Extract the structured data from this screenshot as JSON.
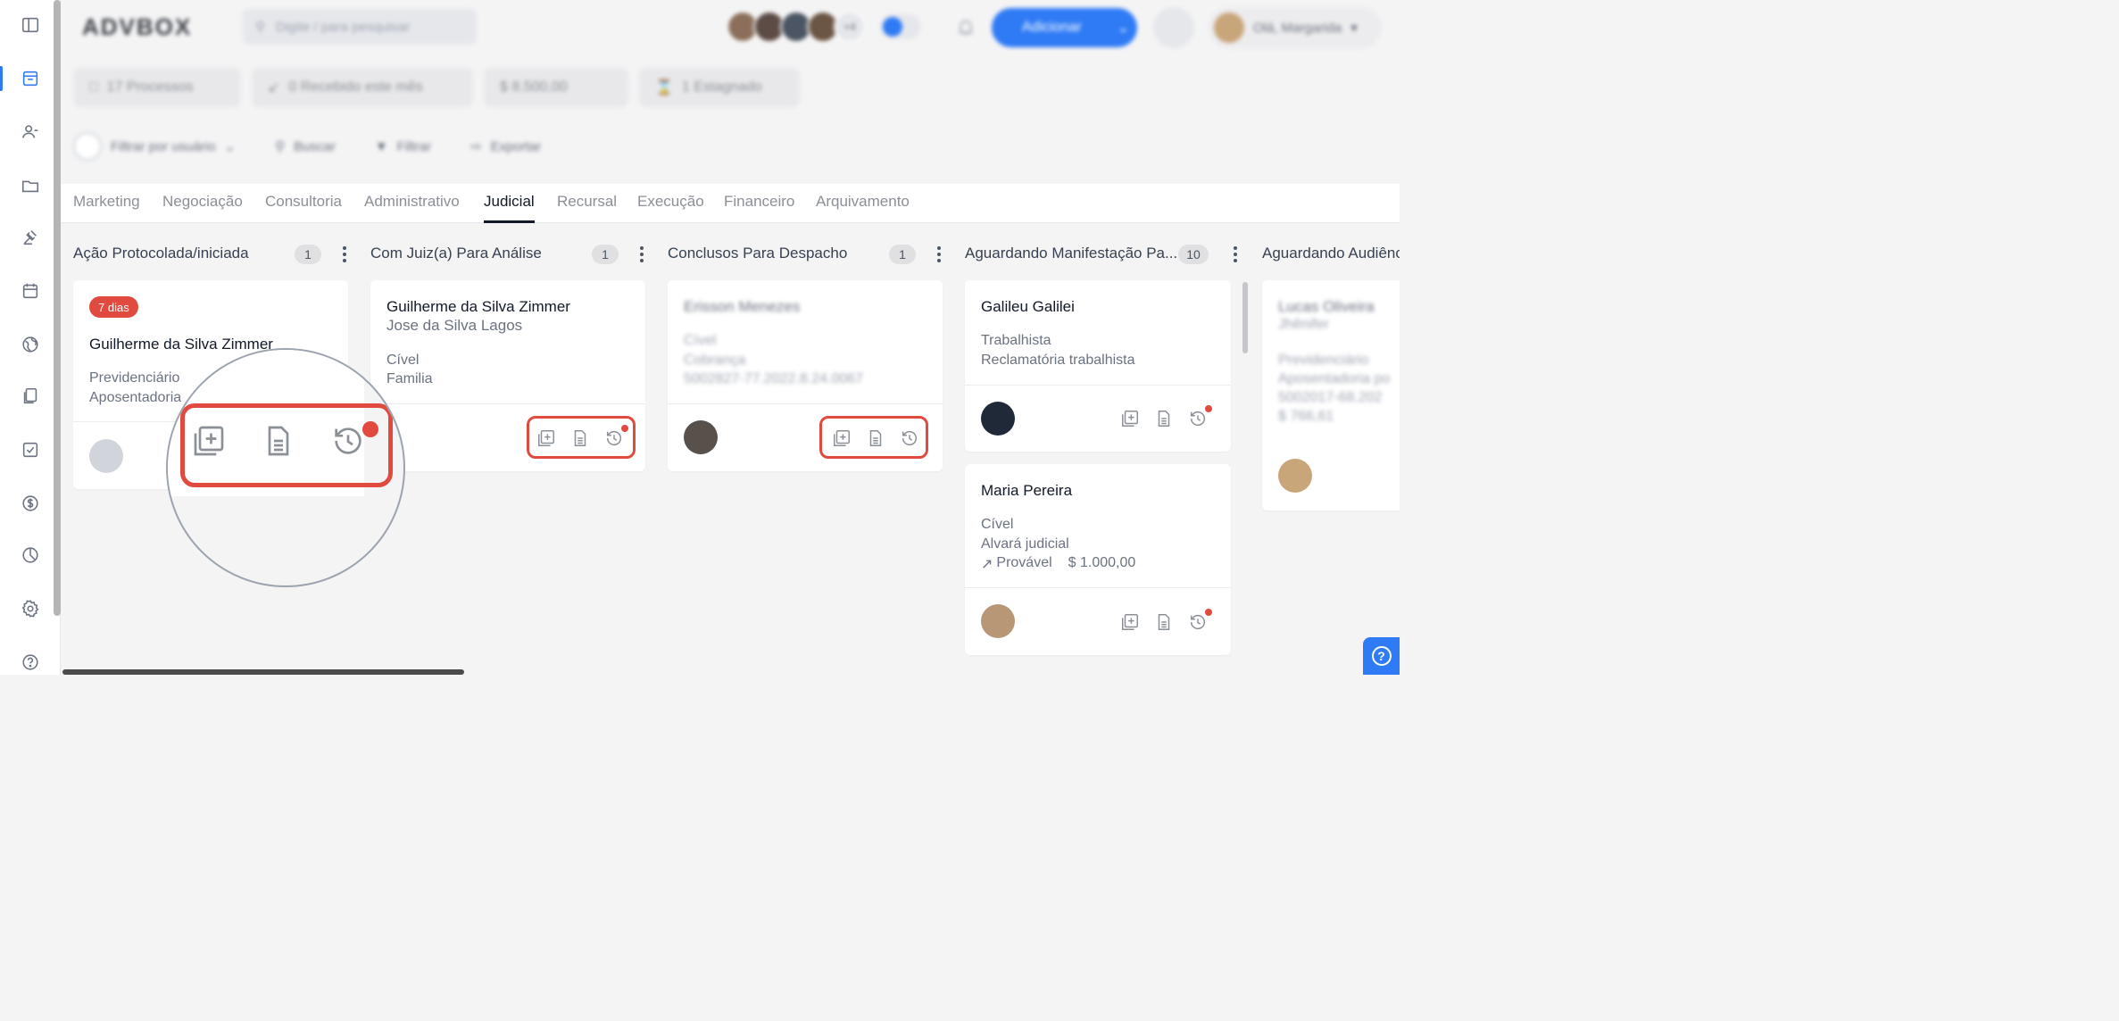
{
  "header": {
    "logo": "ADVBOX",
    "search_placeholder": "Digite / para pesquisar",
    "avatars_more": "+4",
    "add_button": "Adicionar",
    "greeting": "Olá, Margarida"
  },
  "stats": [
    {
      "label": "17 Processos"
    },
    {
      "label": "0 Recebido este mês"
    },
    {
      "label": "$  8.500,00"
    },
    {
      "label": "1 Estagnado"
    }
  ],
  "filters": {
    "user": "Filtrar por usuário",
    "search": "Buscar",
    "filter": "Filtrar",
    "export": "Exportar"
  },
  "tabs": [
    {
      "label": "Marketing"
    },
    {
      "label": "Negociação"
    },
    {
      "label": "Consultoria"
    },
    {
      "label": "Administrativo"
    },
    {
      "label": "Judicial",
      "active": true
    },
    {
      "label": "Recursal"
    },
    {
      "label": "Execução"
    },
    {
      "label": "Financeiro"
    },
    {
      "label": "Arquivamento"
    }
  ],
  "columns": [
    {
      "title": "Ação Protocolada/iniciada",
      "count": "1"
    },
    {
      "title": "Com Juiz(a) Para Análise",
      "count": "1"
    },
    {
      "title": "Conclusos Para Despacho",
      "count": "1"
    },
    {
      "title": "Aguardando Manifestação Pa...",
      "count": "10"
    },
    {
      "title": "Aguardando Audiênc"
    }
  ],
  "cards": {
    "c1": {
      "badge": "7 dias",
      "name": "Guilherme da Silva Zimmer",
      "line1": "Previdenciário",
      "line2": "Aposentadoria"
    },
    "c2": {
      "name": "Guilherme da Silva Zimmer",
      "name2": "Jose da Silva Lagos",
      "line1": "Cível",
      "line2": "Familia"
    },
    "c3": {
      "name": "Erisson Menezes",
      "line1": "Cível",
      "line2": "Cobrança",
      "line3": "5002827-77.2022.8.24.0067"
    },
    "c4": {
      "name": "Galileu Galilei",
      "line1": "Trabalhista",
      "line2": "Reclamatória trabalhista"
    },
    "c5": {
      "name": "Maria Pereira",
      "line1": "Cível",
      "line2": "Alvará judicial",
      "prob": "Provável",
      "value": "$  1.000,00"
    },
    "c6": {
      "name": "Lucas Oliveira",
      "name2": "Jhênifer",
      "line1": "Previdenciário",
      "line2": "Aposentadoria po",
      "line3": "5002017-68.202",
      "value": "$  766,61"
    }
  },
  "colors": {
    "accent": "#2f7bf5",
    "alert": "#e04a3f"
  }
}
